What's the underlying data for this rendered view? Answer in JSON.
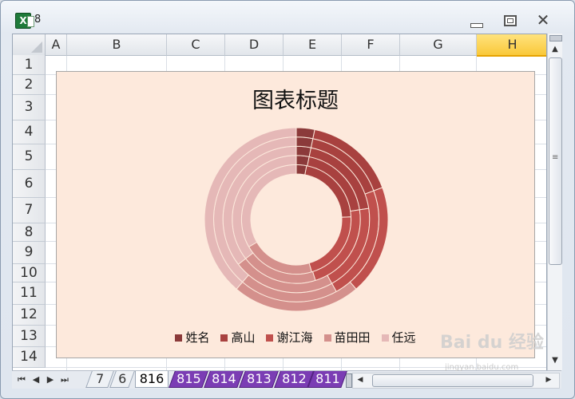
{
  "window": {
    "title": "8"
  },
  "columns": [
    "A",
    "B",
    "C",
    "D",
    "E",
    "F",
    "G",
    "H"
  ],
  "selected_column": "H",
  "rows": [
    "1",
    "2",
    "3",
    "4",
    "5",
    "6",
    "7",
    "8",
    "9",
    "10",
    "11",
    "12",
    "13",
    "14"
  ],
  "sheet_tabs": [
    {
      "label": "7",
      "style": "plain"
    },
    {
      "label": "6",
      "style": "plain"
    },
    {
      "label": "816",
      "style": "active"
    },
    {
      "label": "815",
      "style": "purple"
    },
    {
      "label": "814",
      "style": "purple"
    },
    {
      "label": "813",
      "style": "purple"
    },
    {
      "label": "812",
      "style": "purple"
    },
    {
      "label": "811",
      "style": "purple"
    }
  ],
  "chart": {
    "title": "图表标题",
    "background": "#fde9dc"
  },
  "chart_data": {
    "type": "doughnut",
    "title": "图表标题",
    "legend_position": "bottom",
    "series": [
      {
        "name": "姓名",
        "color": "#8b3a3a",
        "values": [
          1,
          6,
          6,
          6,
          11
        ]
      },
      {
        "name": "高山",
        "color": "#a8413f",
        "values": [
          1,
          6,
          6,
          6,
          11
        ]
      },
      {
        "name": "谢江海",
        "color": "#c0504d",
        "values": [
          1,
          6,
          6,
          6,
          11
        ]
      },
      {
        "name": "苗田田",
        "color": "#d4908c",
        "values": [
          1,
          6,
          6,
          6,
          11
        ]
      },
      {
        "name": "任远",
        "color": "#e5b8b7",
        "values": [
          1,
          6,
          6,
          6,
          11
        ]
      }
    ],
    "rings": [
      {
        "shares": [
          1,
          7,
          7,
          7,
          11
        ]
      },
      {
        "shares": [
          1,
          6,
          7,
          6,
          11
        ]
      },
      {
        "shares": [
          1,
          6,
          6,
          7,
          11
        ]
      },
      {
        "shares": [
          1,
          5,
          7,
          6,
          12
        ]
      },
      {
        "shares": [
          1,
          5,
          6,
          7,
          12
        ]
      }
    ]
  },
  "watermark": {
    "text": "Bai du 经验",
    "sub": "jingyan.baidu.com"
  }
}
